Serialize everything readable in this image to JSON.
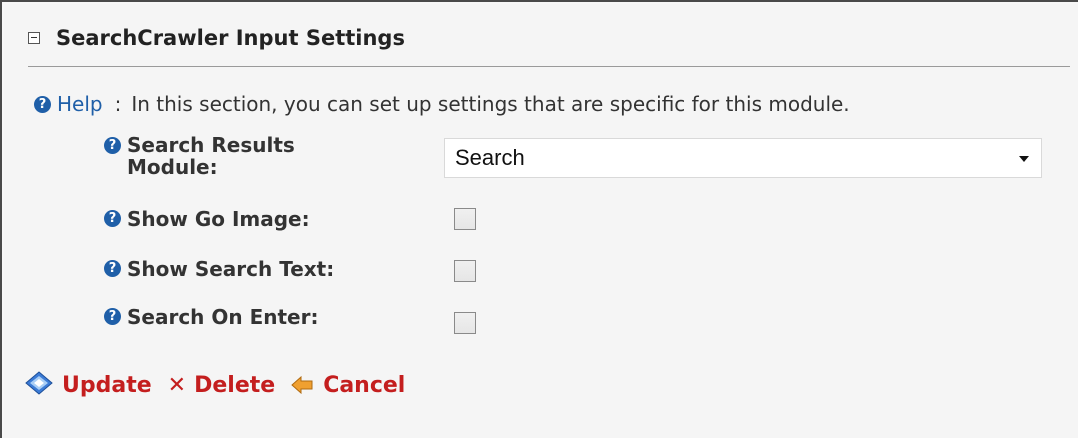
{
  "section": {
    "title": "SearchCrawler Input Settings",
    "collapse_icon": "minus-box-icon"
  },
  "help": {
    "icon": "help-icon",
    "link_label": "Help",
    "colon": ":",
    "text": "In this section, you can set up settings that are specific for this module."
  },
  "fields": {
    "search_results_module": {
      "label_line1": "Search Results",
      "label_line2": "Module:",
      "value": "Search"
    },
    "show_go_image": {
      "label": "Show Go Image:",
      "checked": false
    },
    "show_search_text": {
      "label": "Show Search Text:",
      "checked": false
    },
    "search_on_enter": {
      "label": "Search On Enter:",
      "checked": false
    }
  },
  "actions": {
    "update_label": "Update",
    "delete_label": "Delete",
    "cancel_label": "Cancel"
  },
  "colors": {
    "accent": "#1f5fa8",
    "action_red": "#c41e1e"
  }
}
